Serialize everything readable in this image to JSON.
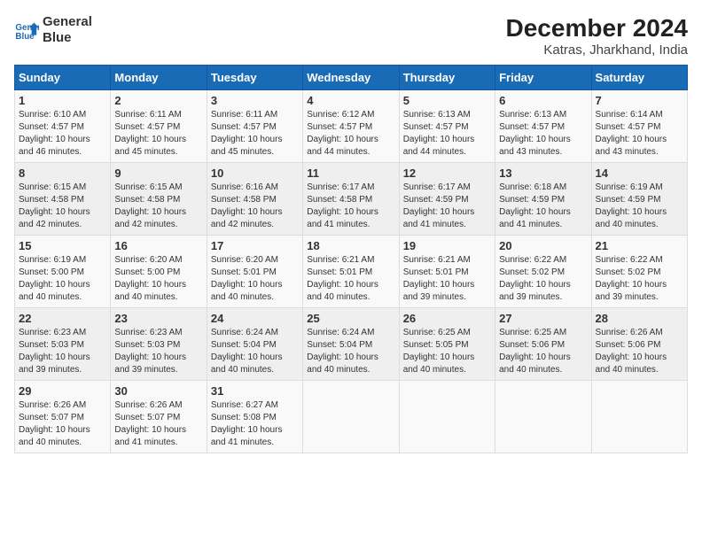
{
  "header": {
    "logo_line1": "General",
    "logo_line2": "Blue",
    "main_title": "December 2024",
    "subtitle": "Katras, Jharkhand, India"
  },
  "calendar": {
    "days_of_week": [
      "Sunday",
      "Monday",
      "Tuesday",
      "Wednesday",
      "Thursday",
      "Friday",
      "Saturday"
    ],
    "weeks": [
      [
        null,
        null,
        null,
        null,
        null,
        null,
        null
      ]
    ],
    "cells": [
      {
        "day": null,
        "info": null
      },
      {
        "day": null,
        "info": null
      },
      {
        "day": null,
        "info": null
      },
      {
        "day": null,
        "info": null
      },
      {
        "day": null,
        "info": null
      },
      {
        "day": null,
        "info": null
      },
      {
        "day": null,
        "info": null
      }
    ]
  },
  "rows": [
    [
      {
        "day": "1",
        "sunrise": "6:10 AM",
        "sunset": "4:57 PM",
        "daylight": "10 hours and 46 minutes."
      },
      {
        "day": "2",
        "sunrise": "6:11 AM",
        "sunset": "4:57 PM",
        "daylight": "10 hours and 45 minutes."
      },
      {
        "day": "3",
        "sunrise": "6:11 AM",
        "sunset": "4:57 PM",
        "daylight": "10 hours and 45 minutes."
      },
      {
        "day": "4",
        "sunrise": "6:12 AM",
        "sunset": "4:57 PM",
        "daylight": "10 hours and 44 minutes."
      },
      {
        "day": "5",
        "sunrise": "6:13 AM",
        "sunset": "4:57 PM",
        "daylight": "10 hours and 44 minutes."
      },
      {
        "day": "6",
        "sunrise": "6:13 AM",
        "sunset": "4:57 PM",
        "daylight": "10 hours and 43 minutes."
      },
      {
        "day": "7",
        "sunrise": "6:14 AM",
        "sunset": "4:57 PM",
        "daylight": "10 hours and 43 minutes."
      }
    ],
    [
      {
        "day": "8",
        "sunrise": "6:15 AM",
        "sunset": "4:58 PM",
        "daylight": "10 hours and 42 minutes."
      },
      {
        "day": "9",
        "sunrise": "6:15 AM",
        "sunset": "4:58 PM",
        "daylight": "10 hours and 42 minutes."
      },
      {
        "day": "10",
        "sunrise": "6:16 AM",
        "sunset": "4:58 PM",
        "daylight": "10 hours and 42 minutes."
      },
      {
        "day": "11",
        "sunrise": "6:17 AM",
        "sunset": "4:58 PM",
        "daylight": "10 hours and 41 minutes."
      },
      {
        "day": "12",
        "sunrise": "6:17 AM",
        "sunset": "4:59 PM",
        "daylight": "10 hours and 41 minutes."
      },
      {
        "day": "13",
        "sunrise": "6:18 AM",
        "sunset": "4:59 PM",
        "daylight": "10 hours and 41 minutes."
      },
      {
        "day": "14",
        "sunrise": "6:19 AM",
        "sunset": "4:59 PM",
        "daylight": "10 hours and 40 minutes."
      }
    ],
    [
      {
        "day": "15",
        "sunrise": "6:19 AM",
        "sunset": "5:00 PM",
        "daylight": "10 hours and 40 minutes."
      },
      {
        "day": "16",
        "sunrise": "6:20 AM",
        "sunset": "5:00 PM",
        "daylight": "10 hours and 40 minutes."
      },
      {
        "day": "17",
        "sunrise": "6:20 AM",
        "sunset": "5:01 PM",
        "daylight": "10 hours and 40 minutes."
      },
      {
        "day": "18",
        "sunrise": "6:21 AM",
        "sunset": "5:01 PM",
        "daylight": "10 hours and 40 minutes."
      },
      {
        "day": "19",
        "sunrise": "6:21 AM",
        "sunset": "5:01 PM",
        "daylight": "10 hours and 39 minutes."
      },
      {
        "day": "20",
        "sunrise": "6:22 AM",
        "sunset": "5:02 PM",
        "daylight": "10 hours and 39 minutes."
      },
      {
        "day": "21",
        "sunrise": "6:22 AM",
        "sunset": "5:02 PM",
        "daylight": "10 hours and 39 minutes."
      }
    ],
    [
      {
        "day": "22",
        "sunrise": "6:23 AM",
        "sunset": "5:03 PM",
        "daylight": "10 hours and 39 minutes."
      },
      {
        "day": "23",
        "sunrise": "6:23 AM",
        "sunset": "5:03 PM",
        "daylight": "10 hours and 39 minutes."
      },
      {
        "day": "24",
        "sunrise": "6:24 AM",
        "sunset": "5:04 PM",
        "daylight": "10 hours and 40 minutes."
      },
      {
        "day": "25",
        "sunrise": "6:24 AM",
        "sunset": "5:04 PM",
        "daylight": "10 hours and 40 minutes."
      },
      {
        "day": "26",
        "sunrise": "6:25 AM",
        "sunset": "5:05 PM",
        "daylight": "10 hours and 40 minutes."
      },
      {
        "day": "27",
        "sunrise": "6:25 AM",
        "sunset": "5:06 PM",
        "daylight": "10 hours and 40 minutes."
      },
      {
        "day": "28",
        "sunrise": "6:26 AM",
        "sunset": "5:06 PM",
        "daylight": "10 hours and 40 minutes."
      }
    ],
    [
      {
        "day": "29",
        "sunrise": "6:26 AM",
        "sunset": "5:07 PM",
        "daylight": "10 hours and 40 minutes."
      },
      {
        "day": "30",
        "sunrise": "6:26 AM",
        "sunset": "5:07 PM",
        "daylight": "10 hours and 41 minutes."
      },
      {
        "day": "31",
        "sunrise": "6:27 AM",
        "sunset": "5:08 PM",
        "daylight": "10 hours and 41 minutes."
      },
      null,
      null,
      null,
      null
    ]
  ],
  "labels": {
    "sunrise_label": "Sunrise:",
    "sunset_label": "Sunset:",
    "daylight_label": "Daylight:"
  }
}
